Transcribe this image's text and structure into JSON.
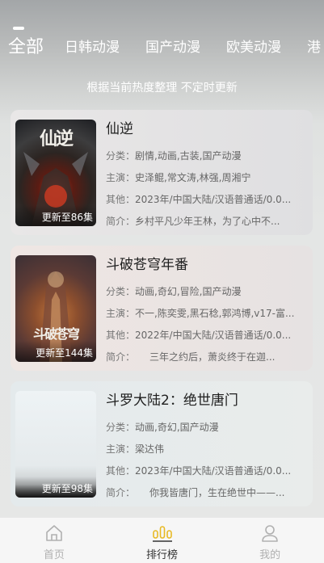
{
  "tabs": [
    "全部",
    "日韩动漫",
    "国产动漫",
    "欧美动漫",
    "港"
  ],
  "subtitle": "根据当前热度整理 不定时更新",
  "labels": {
    "genre": "分类：",
    "cast": "主演：",
    "other": "其他：",
    "intro": "简介："
  },
  "items": [
    {
      "title": "仙逆",
      "poster_text": "仙逆",
      "badge": "更新至86集",
      "genre": "剧情,动画,古装,国产动漫",
      "cast": "史泽鲲,常文涛,林强,周湘宁",
      "other": "2023年/中国大陆/汉语普通话/0.0...",
      "intro": "乡村平凡少年王林，为了心中不..."
    },
    {
      "title": "斗破苍穹年番",
      "poster_text": "斗破苍穹",
      "badge": "更新至144集",
      "genre": "动画,奇幻,冒险,国产动漫",
      "cast": "不一,陈奕雯,黑石稔,郭鸿博,v17-富...",
      "other": "2022年/中国大陆/汉语普通话/0.0...",
      "intro": "　　三年之约后，萧炎终于在迦..."
    },
    {
      "title": "斗罗大陆2：绝世唐门",
      "poster_text": "",
      "badge": "更新至98集",
      "genre": "动画,奇幻,国产动漫",
      "cast": "梁达伟",
      "other": "2023年/中国大陆/汉语普通话/0.0...",
      "intro": "　　你我皆唐门，生在绝世中——..."
    }
  ],
  "nav": [
    {
      "label": "首页",
      "icon": "home-icon"
    },
    {
      "label": "排行榜",
      "icon": "ranking-icon"
    },
    {
      "label": "我的",
      "icon": "user-icon"
    }
  ],
  "colors": {
    "accent": "#e8b923",
    "nav_inactive": "#b0b0b0",
    "nav_active": "#333333"
  }
}
